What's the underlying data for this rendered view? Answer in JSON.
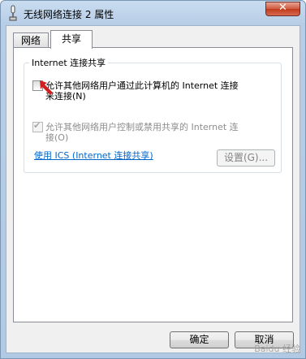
{
  "window": {
    "title": "无线网络连接 2 属性"
  },
  "tabs": [
    {
      "label": "网络"
    },
    {
      "label": "共享"
    }
  ],
  "sharing": {
    "group_title": "Internet 连接共享",
    "allow_share_line1": "允许其他网络用户通过此计算机的 Internet 连接",
    "allow_share_line2": "来连接(N)",
    "allow_share_checked": false,
    "allow_control_line1": "允许其他网络用户控制或禁用共享的 Internet 连",
    "allow_control_line2": "接(O)",
    "allow_control_checked": true,
    "ics_link": "使用 ICS (Internet 连接共享)",
    "settings_label": "设置(G)..."
  },
  "footer": {
    "ok_label": "确定",
    "cancel_label": "取消"
  },
  "watermark": "Baidu 经验",
  "colors": {
    "link": "#0066cc",
    "arrow": "#d11f1f"
  }
}
